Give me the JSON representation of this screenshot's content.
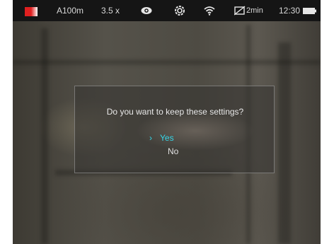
{
  "status_bar": {
    "palette_icon": "color-palette-icon",
    "range": "A100m",
    "zoom": "3.5 x",
    "eye_icon": "eye-icon",
    "stabilizer_icon": "settings-icon",
    "wifi_icon": "wifi-icon",
    "display_off_icon": "display-off-icon",
    "display_off_timer": "2min",
    "time": "12:30",
    "battery_icon": "battery-icon"
  },
  "dialog": {
    "question": "Do you want to keep these settings?",
    "options": [
      {
        "label": "Yes",
        "selected": true
      },
      {
        "label": "No",
        "selected": false
      }
    ],
    "selection_marker": "›"
  },
  "colors": {
    "status_bar_bg": "#151515",
    "selected_option": "#35d6e8",
    "palette_red": "#e02020"
  }
}
